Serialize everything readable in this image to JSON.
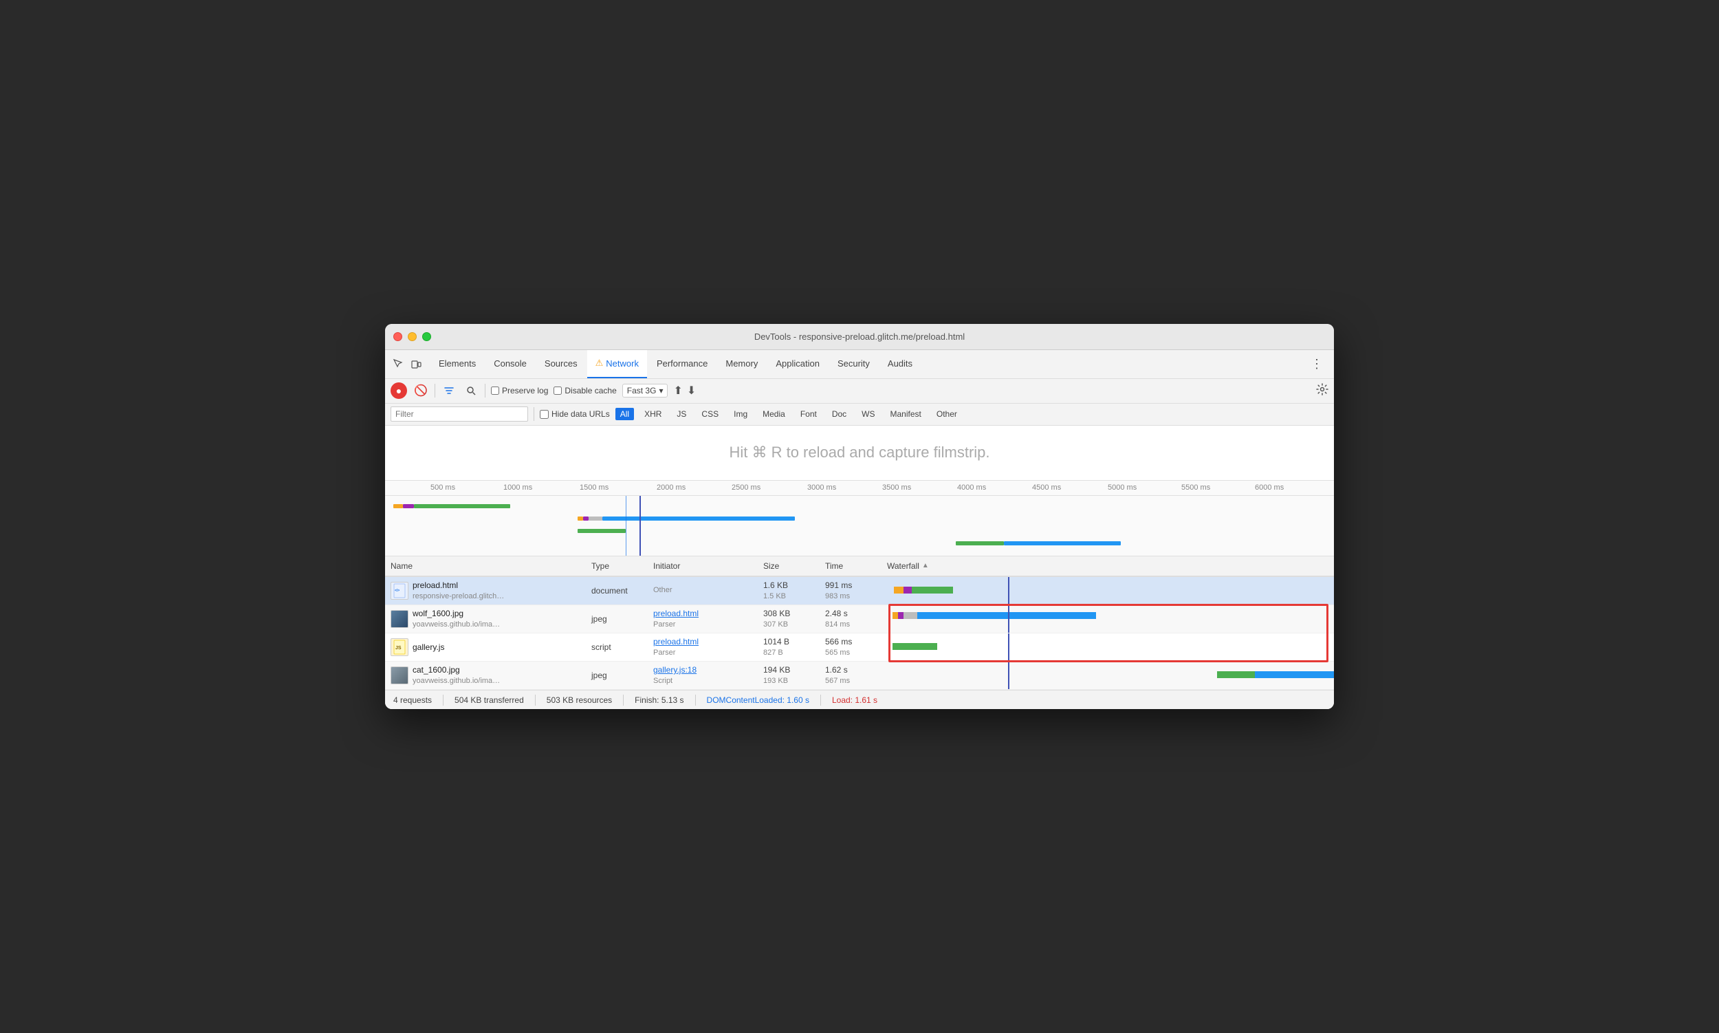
{
  "window": {
    "title": "DevTools - responsive-preload.glitch.me/preload.html"
  },
  "tabs": [
    {
      "label": "Elements",
      "active": false
    },
    {
      "label": "Console",
      "active": false
    },
    {
      "label": "Sources",
      "active": false
    },
    {
      "label": "Network",
      "active": true,
      "warning": true
    },
    {
      "label": "Performance",
      "active": false
    },
    {
      "label": "Memory",
      "active": false
    },
    {
      "label": "Application",
      "active": false
    },
    {
      "label": "Security",
      "active": false
    },
    {
      "label": "Audits",
      "active": false
    }
  ],
  "toolbar": {
    "preserve_log_label": "Preserve log",
    "disable_cache_label": "Disable cache",
    "throttle": "Fast 3G"
  },
  "filter": {
    "placeholder": "Filter",
    "hide_data_urls_label": "Hide data URLs",
    "types": [
      "All",
      "XHR",
      "JS",
      "CSS",
      "Img",
      "Media",
      "Font",
      "Doc",
      "WS",
      "Manifest",
      "Other"
    ]
  },
  "filmstrip": {
    "hint": "Hit ⌘ R to reload and capture filmstrip."
  },
  "timeline": {
    "labels": [
      "500 ms",
      "1000 ms",
      "1500 ms",
      "2000 ms",
      "2500 ms",
      "3000 ms",
      "3500 ms",
      "4000 ms",
      "4500 ms",
      "5000 ms",
      "5500 ms",
      "6000 ms"
    ]
  },
  "table": {
    "columns": [
      "Name",
      "Type",
      "Initiator",
      "Size",
      "Time",
      "Waterfall"
    ],
    "rows": [
      {
        "icon": "html",
        "name": "preload.html",
        "name_sub": "responsive-preload.glitch…",
        "type": "document",
        "initiator": "Other",
        "initiator_link": false,
        "size_main": "1.6 KB",
        "size_sub": "1.5 KB",
        "time_main": "991 ms",
        "time_sub": "983 ms",
        "selected": true
      },
      {
        "icon": "jpg",
        "name": "wolf_1600.jpg",
        "name_sub": "yoavweiss.github.io/ima…",
        "type": "jpeg",
        "initiator": "preload.html",
        "initiator_link": true,
        "initiator_sub": "Parser",
        "size_main": "308 KB",
        "size_sub": "307 KB",
        "time_main": "2.48 s",
        "time_sub": "814 ms",
        "selected": false
      },
      {
        "icon": "js",
        "name": "gallery.js",
        "name_sub": "",
        "type": "script",
        "initiator": "preload.html",
        "initiator_link": true,
        "initiator_sub": "Parser",
        "size_main": "1014 B",
        "size_sub": "827 B",
        "time_main": "566 ms",
        "time_sub": "565 ms",
        "selected": false
      },
      {
        "icon": "jpg",
        "name": "cat_1600.jpg",
        "name_sub": "yoavweiss.github.io/ima…",
        "type": "jpeg",
        "initiator": "gallery.js:18",
        "initiator_link": true,
        "initiator_sub": "Script",
        "size_main": "194 KB",
        "size_sub": "193 KB",
        "time_main": "1.62 s",
        "time_sub": "567 ms",
        "selected": false
      }
    ]
  },
  "statusbar": {
    "requests": "4 requests",
    "transferred": "504 KB transferred",
    "resources": "503 KB resources",
    "finish": "Finish: 5.13 s",
    "dom_content": "DOMContentLoaded: 1.60 s",
    "load": "Load: 1.61 s"
  }
}
